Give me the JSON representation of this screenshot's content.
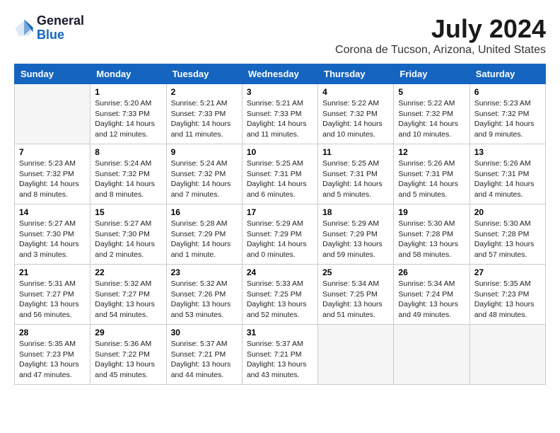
{
  "logo": {
    "general": "General",
    "blue": "Blue"
  },
  "title": "July 2024",
  "subtitle": "Corona de Tucson, Arizona, United States",
  "headers": [
    "Sunday",
    "Monday",
    "Tuesday",
    "Wednesday",
    "Thursday",
    "Friday",
    "Saturday"
  ],
  "weeks": [
    [
      {
        "day": "",
        "info": ""
      },
      {
        "day": "1",
        "info": "Sunrise: 5:20 AM\nSunset: 7:33 PM\nDaylight: 14 hours\nand 12 minutes."
      },
      {
        "day": "2",
        "info": "Sunrise: 5:21 AM\nSunset: 7:33 PM\nDaylight: 14 hours\nand 11 minutes."
      },
      {
        "day": "3",
        "info": "Sunrise: 5:21 AM\nSunset: 7:33 PM\nDaylight: 14 hours\nand 11 minutes."
      },
      {
        "day": "4",
        "info": "Sunrise: 5:22 AM\nSunset: 7:32 PM\nDaylight: 14 hours\nand 10 minutes."
      },
      {
        "day": "5",
        "info": "Sunrise: 5:22 AM\nSunset: 7:32 PM\nDaylight: 14 hours\nand 10 minutes."
      },
      {
        "day": "6",
        "info": "Sunrise: 5:23 AM\nSunset: 7:32 PM\nDaylight: 14 hours\nand 9 minutes."
      }
    ],
    [
      {
        "day": "7",
        "info": "Sunrise: 5:23 AM\nSunset: 7:32 PM\nDaylight: 14 hours\nand 8 minutes."
      },
      {
        "day": "8",
        "info": "Sunrise: 5:24 AM\nSunset: 7:32 PM\nDaylight: 14 hours\nand 8 minutes."
      },
      {
        "day": "9",
        "info": "Sunrise: 5:24 AM\nSunset: 7:32 PM\nDaylight: 14 hours\nand 7 minutes."
      },
      {
        "day": "10",
        "info": "Sunrise: 5:25 AM\nSunset: 7:31 PM\nDaylight: 14 hours\nand 6 minutes."
      },
      {
        "day": "11",
        "info": "Sunrise: 5:25 AM\nSunset: 7:31 PM\nDaylight: 14 hours\nand 5 minutes."
      },
      {
        "day": "12",
        "info": "Sunrise: 5:26 AM\nSunset: 7:31 PM\nDaylight: 14 hours\nand 5 minutes."
      },
      {
        "day": "13",
        "info": "Sunrise: 5:26 AM\nSunset: 7:31 PM\nDaylight: 14 hours\nand 4 minutes."
      }
    ],
    [
      {
        "day": "14",
        "info": "Sunrise: 5:27 AM\nSunset: 7:30 PM\nDaylight: 14 hours\nand 3 minutes."
      },
      {
        "day": "15",
        "info": "Sunrise: 5:27 AM\nSunset: 7:30 PM\nDaylight: 14 hours\nand 2 minutes."
      },
      {
        "day": "16",
        "info": "Sunrise: 5:28 AM\nSunset: 7:29 PM\nDaylight: 14 hours\nand 1 minute."
      },
      {
        "day": "17",
        "info": "Sunrise: 5:29 AM\nSunset: 7:29 PM\nDaylight: 14 hours\nand 0 minutes."
      },
      {
        "day": "18",
        "info": "Sunrise: 5:29 AM\nSunset: 7:29 PM\nDaylight: 13 hours\nand 59 minutes."
      },
      {
        "day": "19",
        "info": "Sunrise: 5:30 AM\nSunset: 7:28 PM\nDaylight: 13 hours\nand 58 minutes."
      },
      {
        "day": "20",
        "info": "Sunrise: 5:30 AM\nSunset: 7:28 PM\nDaylight: 13 hours\nand 57 minutes."
      }
    ],
    [
      {
        "day": "21",
        "info": "Sunrise: 5:31 AM\nSunset: 7:27 PM\nDaylight: 13 hours\nand 56 minutes."
      },
      {
        "day": "22",
        "info": "Sunrise: 5:32 AM\nSunset: 7:27 PM\nDaylight: 13 hours\nand 54 minutes."
      },
      {
        "day": "23",
        "info": "Sunrise: 5:32 AM\nSunset: 7:26 PM\nDaylight: 13 hours\nand 53 minutes."
      },
      {
        "day": "24",
        "info": "Sunrise: 5:33 AM\nSunset: 7:25 PM\nDaylight: 13 hours\nand 52 minutes."
      },
      {
        "day": "25",
        "info": "Sunrise: 5:34 AM\nSunset: 7:25 PM\nDaylight: 13 hours\nand 51 minutes."
      },
      {
        "day": "26",
        "info": "Sunrise: 5:34 AM\nSunset: 7:24 PM\nDaylight: 13 hours\nand 49 minutes."
      },
      {
        "day": "27",
        "info": "Sunrise: 5:35 AM\nSunset: 7:23 PM\nDaylight: 13 hours\nand 48 minutes."
      }
    ],
    [
      {
        "day": "28",
        "info": "Sunrise: 5:35 AM\nSunset: 7:23 PM\nDaylight: 13 hours\nand 47 minutes."
      },
      {
        "day": "29",
        "info": "Sunrise: 5:36 AM\nSunset: 7:22 PM\nDaylight: 13 hours\nand 45 minutes."
      },
      {
        "day": "30",
        "info": "Sunrise: 5:37 AM\nSunset: 7:21 PM\nDaylight: 13 hours\nand 44 minutes."
      },
      {
        "day": "31",
        "info": "Sunrise: 5:37 AM\nSunset: 7:21 PM\nDaylight: 13 hours\nand 43 minutes."
      },
      {
        "day": "",
        "info": ""
      },
      {
        "day": "",
        "info": ""
      },
      {
        "day": "",
        "info": ""
      }
    ]
  ]
}
